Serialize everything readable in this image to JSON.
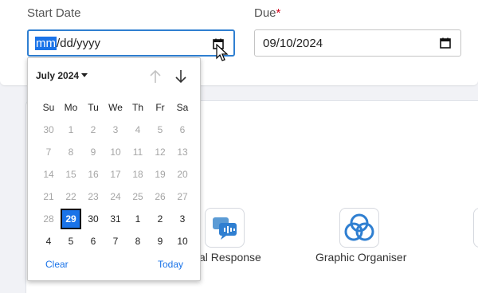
{
  "form": {
    "start_date": {
      "label": "Start Date",
      "segments": [
        "mm",
        "/dd/yyyy"
      ]
    },
    "due": {
      "label": "Due",
      "required_mark": "*",
      "value": "09/10/2024"
    }
  },
  "tools": [
    {
      "label": "al Response",
      "icon": "chat-audio-icon"
    },
    {
      "label": "Graphic Organiser",
      "icon": "venn-diagram-icon"
    }
  ],
  "picker": {
    "month_label": "July 2024",
    "weekdays": [
      "Su",
      "Mo",
      "Tu",
      "We",
      "Th",
      "Fr",
      "Sa"
    ],
    "weeks": [
      [
        {
          "d": "30",
          "s": "muted"
        },
        {
          "d": "1",
          "s": "muted"
        },
        {
          "d": "2",
          "s": "muted"
        },
        {
          "d": "3",
          "s": "muted"
        },
        {
          "d": "4",
          "s": "muted"
        },
        {
          "d": "5",
          "s": "muted"
        },
        {
          "d": "6",
          "s": "muted"
        }
      ],
      [
        {
          "d": "7",
          "s": "muted"
        },
        {
          "d": "8",
          "s": "muted"
        },
        {
          "d": "9",
          "s": "muted"
        },
        {
          "d": "10",
          "s": "muted"
        },
        {
          "d": "11",
          "s": "muted"
        },
        {
          "d": "12",
          "s": "muted"
        },
        {
          "d": "13",
          "s": "muted"
        }
      ],
      [
        {
          "d": "14",
          "s": "muted"
        },
        {
          "d": "15",
          "s": "muted"
        },
        {
          "d": "16",
          "s": "muted"
        },
        {
          "d": "17",
          "s": "muted"
        },
        {
          "d": "18",
          "s": "muted"
        },
        {
          "d": "19",
          "s": "muted"
        },
        {
          "d": "20",
          "s": "muted"
        }
      ],
      [
        {
          "d": "21",
          "s": "muted"
        },
        {
          "d": "22",
          "s": "muted"
        },
        {
          "d": "23",
          "s": "muted"
        },
        {
          "d": "24",
          "s": "muted"
        },
        {
          "d": "25",
          "s": "muted"
        },
        {
          "d": "26",
          "s": "muted"
        },
        {
          "d": "27",
          "s": "muted"
        }
      ],
      [
        {
          "d": "28",
          "s": "muted"
        },
        {
          "d": "29",
          "s": "today"
        },
        {
          "d": "30",
          "s": "cur"
        },
        {
          "d": "31",
          "s": "cur"
        },
        {
          "d": "1",
          "s": "cur"
        },
        {
          "d": "2",
          "s": "cur"
        },
        {
          "d": "3",
          "s": "cur"
        }
      ],
      [
        {
          "d": "4",
          "s": "cur"
        },
        {
          "d": "5",
          "s": "cur"
        },
        {
          "d": "6",
          "s": "cur"
        },
        {
          "d": "7",
          "s": "cur"
        },
        {
          "d": "8",
          "s": "cur"
        },
        {
          "d": "9",
          "s": "cur"
        },
        {
          "d": "10",
          "s": "cur"
        }
      ]
    ],
    "clear_label": "Clear",
    "today_label": "Today"
  },
  "colors": {
    "accent": "#1a73e8",
    "focus": "#2f7fd1",
    "required": "#d0021b",
    "muted_day": "#a5a5a5"
  }
}
